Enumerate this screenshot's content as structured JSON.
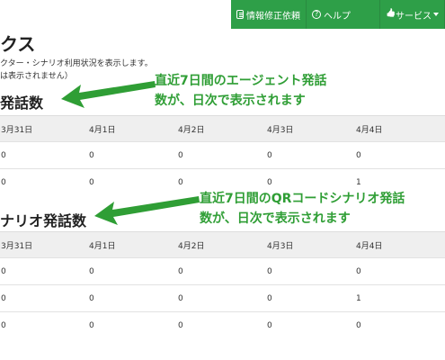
{
  "topbar": {
    "buttons": [
      {
        "label": "情報修正依頼",
        "icon": "document-icon"
      },
      {
        "label": "ヘルプ",
        "icon": "question-circle-icon"
      },
      {
        "label": "サービス",
        "icon": "thumbs-up-icon"
      }
    ]
  },
  "page": {
    "title": "クス",
    "description_line1": "クター・シナリオ利用状況を表示します。",
    "description_line2": "は表示されません）"
  },
  "section1": {
    "title": "発話数",
    "columns": [
      "3月31日",
      "4月1日",
      "4月2日",
      "4月3日",
      "4月4日"
    ],
    "rows": [
      [
        "0",
        "0",
        "0",
        "0",
        "0"
      ],
      [
        "0",
        "0",
        "0",
        "0",
        "1"
      ]
    ]
  },
  "section2": {
    "title": "ナリオ発話数",
    "columns": [
      "3月31日",
      "4月1日",
      "4月2日",
      "4月3日",
      "4月4日"
    ],
    "rows": [
      [
        "0",
        "0",
        "0",
        "0",
        "0"
      ],
      [
        "0",
        "0",
        "0",
        "0",
        "1"
      ],
      [
        "0",
        "0",
        "0",
        "0",
        "0"
      ]
    ]
  },
  "annotations": {
    "a1_line1": "直近7日間のエージェント発話",
    "a1_line2": "数が、日次で表示されます",
    "a2_line1": "直近7日間のQRコードシナリオ発話",
    "a2_line2": "数が、日次で表示されます",
    "color": "#2f9e35"
  },
  "colors": {
    "button_green": "#2e9f48",
    "header_gray": "#efefef"
  }
}
